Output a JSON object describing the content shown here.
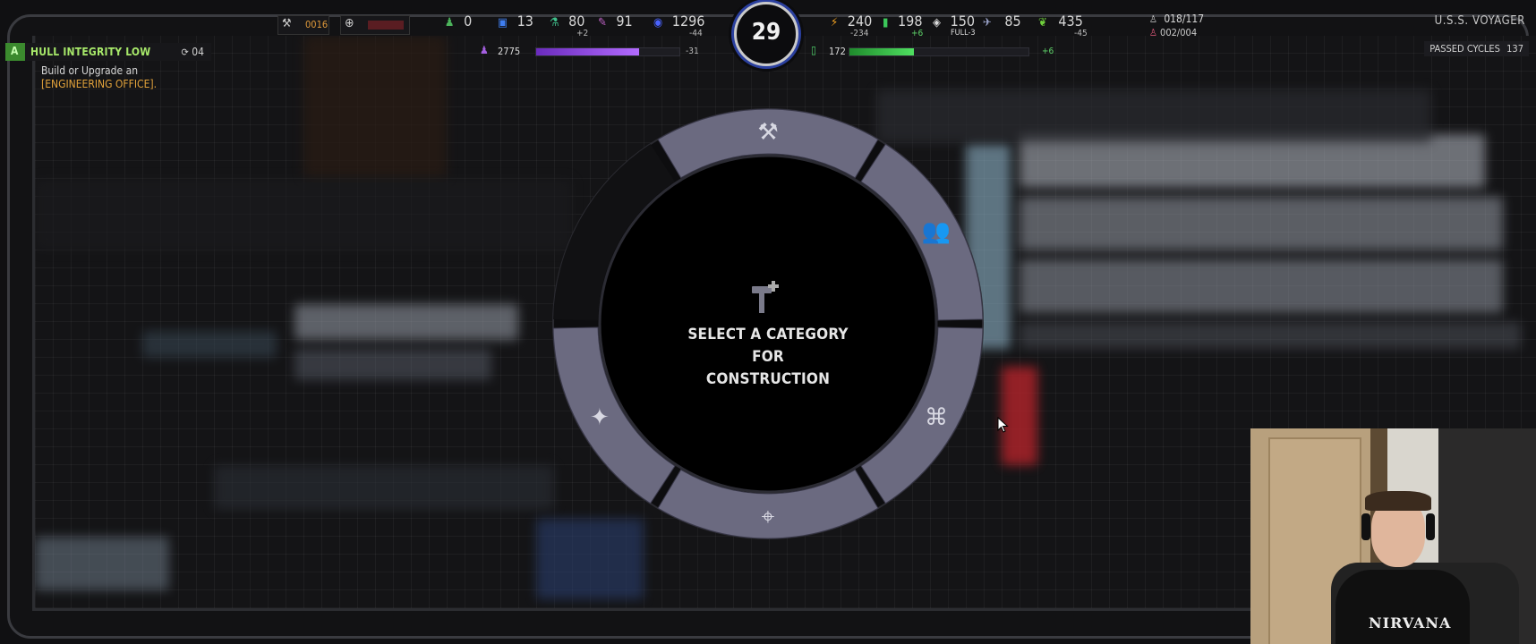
{
  "hud": {
    "left_slot_value": "0016",
    "resources": [
      {
        "icon": "crew-icon",
        "value": "0",
        "delta": ""
      },
      {
        "icon": "chip-icon",
        "value": "13",
        "delta": ""
      },
      {
        "icon": "flask-icon",
        "value": "80",
        "delta": "+2"
      },
      {
        "icon": "feather-icon",
        "value": "91",
        "delta": ""
      },
      {
        "icon": "dilithium-icon",
        "value": "1296",
        "delta": "-44"
      },
      {
        "icon": "energy-icon",
        "value": "240",
        "delta": "-234"
      },
      {
        "icon": "battery-icon",
        "value": "198",
        "delta": "+6"
      },
      {
        "icon": "armor-icon",
        "value": "150",
        "delta": "FULL-3"
      },
      {
        "icon": "shuttle-icon",
        "value": "85",
        "delta": ""
      },
      {
        "icon": "leaf-icon",
        "value": "435",
        "delta": "-45"
      }
    ],
    "crew_count": "018/117",
    "officer_count": "002/004",
    "turn": "29",
    "purple_bar": {
      "value": "2775",
      "delta": "-31",
      "fill": 0.72
    },
    "green_bar": {
      "value": "172",
      "delta": "+6",
      "fill": 0.36
    }
  },
  "objective": {
    "letter": "A",
    "title": "HULL INTEGRITY LOW",
    "count": "04",
    "body_line1": "Build or Upgrade an",
    "body_line2": "[ENGINEERING OFFICE]."
  },
  "ship": {
    "name": "U.S.S. VOYAGER",
    "cycles_label": "PASSED CYCLES",
    "cycles_value": "137"
  },
  "radial_menu": {
    "center_line1": "SELECT A CATEGORY FOR",
    "center_line2": "CONSTRUCTION",
    "segments": [
      {
        "name": "engineering",
        "icon": "tools-icon"
      },
      {
        "name": "crew",
        "icon": "people-icon"
      },
      {
        "name": "systems",
        "icon": "network-icon"
      },
      {
        "name": "tactical",
        "icon": "crosshair-icon"
      },
      {
        "name": "starfleet",
        "icon": "insignia-icon"
      }
    ],
    "colors": {
      "segment": "#6b6a80",
      "disabled": "#111113",
      "inner": "#000000"
    }
  },
  "webcam": {
    "shirt_text": "NIRVANA"
  }
}
